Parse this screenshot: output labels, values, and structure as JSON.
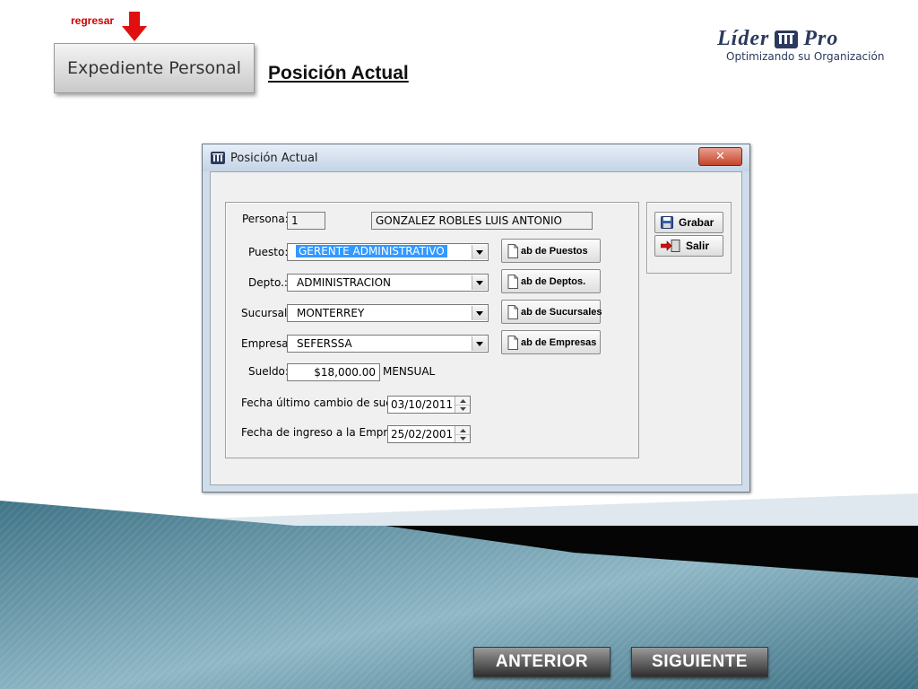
{
  "header": {
    "back_link": "regresar",
    "section_button": "Expediente Personal",
    "slide_title": "Posición Actual"
  },
  "logo": {
    "name_part1": "Líder",
    "name_part2": "Pro",
    "tagline": "Optimizando su Organización"
  },
  "window": {
    "title": "Posición Actual",
    "close_glyph": "✕",
    "form": {
      "persona_label": "Persona:",
      "persona_id": "1",
      "persona_name": "GONZALEZ ROBLES LUIS ANTONIO",
      "puesto_label": "Puesto:",
      "puesto_value": "GERENTE ADMINISTRATIVO",
      "puesto_button": "ab de Puestos",
      "depto_label": "Depto.:",
      "depto_value": "ADMINISTRACION",
      "depto_button": "ab de Deptos.",
      "sucursal_label": "Sucursal:",
      "sucursal_value": "MONTERREY",
      "sucursal_button": "ab de Sucursales",
      "empresa_label": "Empresa:",
      "empresa_value": "SEFERSSA",
      "empresa_button": "ab de Empresas",
      "sueldo_label": "Sueldo:",
      "sueldo_value": "$18,000.00",
      "sueldo_period": "MENSUAL",
      "fecha_cambio_label": "Fecha último cambio de sueldo:",
      "fecha_cambio_value": "03/10/2011",
      "fecha_ingreso_label": "Fecha de ingreso a la Empresa:",
      "fecha_ingreso_value": "25/02/2001"
    },
    "actions": {
      "save": "Grabar",
      "exit": "Salir"
    }
  },
  "navigation": {
    "prev": "ANTERIOR",
    "next": "SIGUIENTE"
  },
  "colors": {
    "accent_red": "#d00000",
    "logo_navy": "#2b3a5e",
    "selection_blue": "#3399ff",
    "band_teal": "#4f8497"
  },
  "icons": [
    "down-arrow-icon",
    "app-icon",
    "close-icon",
    "document-icon",
    "save-disk-icon",
    "exit-door-icon",
    "combo-chevron-icon",
    "spinner-arrow-icon"
  ]
}
